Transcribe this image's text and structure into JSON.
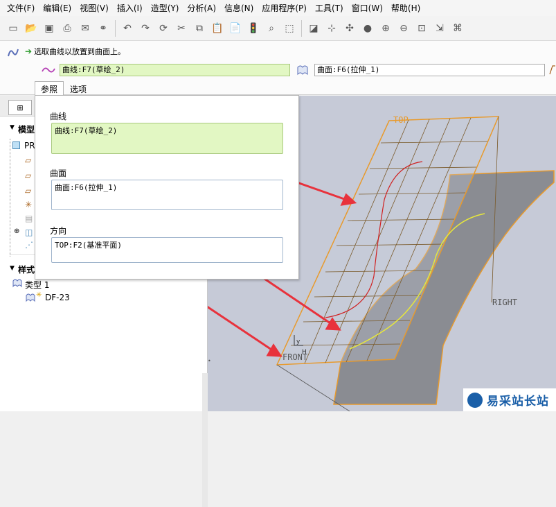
{
  "menu": [
    "文件(F)",
    "编辑(E)",
    "视图(V)",
    "插入(I)",
    "造型(Y)",
    "分析(A)",
    "信息(N)",
    "应用程序(P)",
    "工具(T)",
    "窗口(W)",
    "帮助(H)"
  ],
  "dashboard": {
    "prompt": "选取曲线以放置到曲面上。",
    "curve_value": "曲线:F7(草绘_2)",
    "surface_value": "曲面:F6(拉伸_1)",
    "tabs": [
      "参照",
      "选项"
    ]
  },
  "popup": {
    "curve_label": "曲线",
    "curve_value": "曲线:F7(草绘_2)",
    "surface_label": "曲面",
    "surface_value": "曲面:F6(拉伸_1)",
    "direction_label": "方向",
    "direction_value": "TOP:F2(基准平面)"
  },
  "model_tree": {
    "section_title": "模型",
    "root_label": "PR",
    "style_title": "样式",
    "type_item": "类型 1",
    "df_item": "DF-23"
  },
  "viewport": {
    "label_top": "TOP",
    "label_right": "RIGHT",
    "label_front": "FRONT"
  },
  "watermark": {
    "text": "易采站长站"
  },
  "colors": {
    "curve_field_bg": "#e2f7c3",
    "viewport_bg": "#c6cad7",
    "arrow_red": "#e8323c",
    "plane_orange": "#e89a2c"
  }
}
